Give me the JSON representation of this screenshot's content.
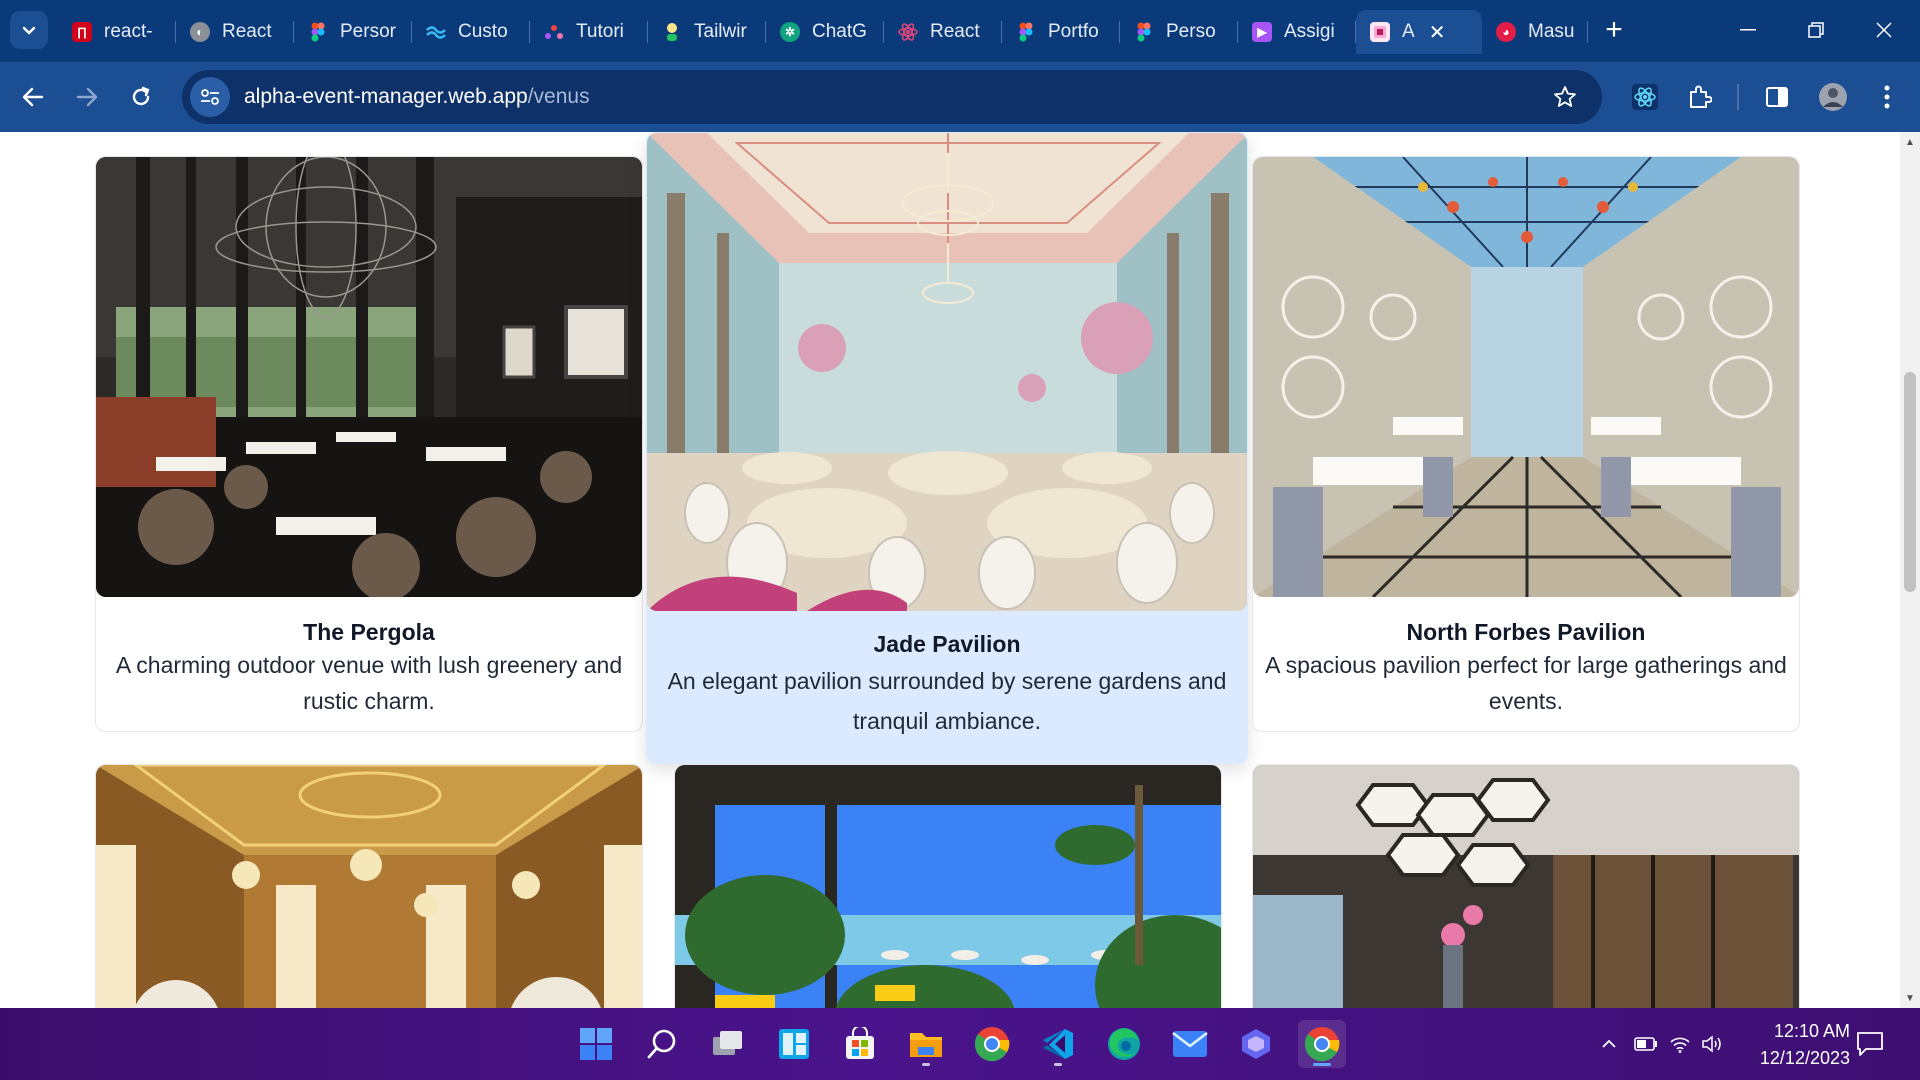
{
  "browser": {
    "tabs": [
      {
        "label": "react-",
        "icon": "react-tab-favicon",
        "color": "#d0021b"
      },
      {
        "label": "React",
        "icon": "globe-favicon",
        "color": "#8a8f98"
      },
      {
        "label": "Persor",
        "icon": "figma-favicon",
        "color": "#f24e1e"
      },
      {
        "label": "Custo",
        "icon": "wave-favicon",
        "color": "#38bdf8"
      },
      {
        "label": "Tutori",
        "icon": "dots-favicon",
        "color": "#ef4444"
      },
      {
        "label": "Tailwir",
        "icon": "person-favicon",
        "color": "#22c55e"
      },
      {
        "label": "ChatG",
        "icon": "chatgpt-favicon",
        "color": "#10a37f"
      },
      {
        "label": "React",
        "icon": "react-favicon",
        "color": "#e0457b"
      },
      {
        "label": "Portfo",
        "icon": "figma-favicon",
        "color": "#f24e1e"
      },
      {
        "label": "Perso",
        "icon": "figma-favicon",
        "color": "#f24e1e"
      },
      {
        "label": "Assigi",
        "icon": "assignment-favicon",
        "color": "#a855f7"
      },
      {
        "label": "A",
        "icon": "event-manager-favicon",
        "color": "#f9a8d4",
        "active": true
      },
      {
        "label": "Masu",
        "icon": "profile-favicon",
        "color": "#e11d48"
      }
    ],
    "new_tab": "+",
    "address": {
      "host": "alpha-event-manager.web.app",
      "path": "/venus"
    }
  },
  "venues": [
    {
      "title": "The Pergola",
      "description": "A charming outdoor venue with lush greenery and rustic charm."
    },
    {
      "title": "Jade Pavilion",
      "description": "An elegant pavilion surrounded by serene gardens and tranquil ambiance."
    },
    {
      "title": "North Forbes Pavilion",
      "description": "A spacious pavilion perfect for large gatherings and events."
    },
    {
      "title": "",
      "description": ""
    },
    {
      "title": "",
      "description": ""
    },
    {
      "title": "",
      "description": ""
    }
  ],
  "taskbar": {
    "apps": [
      "windows-start",
      "search",
      "task-view",
      "widgets",
      "microsoft-store",
      "file-explorer",
      "chrome",
      "vscode",
      "edge",
      "mail",
      "copilot",
      "chrome-active"
    ],
    "time": "12:10 AM",
    "date": "12/12/2023"
  }
}
